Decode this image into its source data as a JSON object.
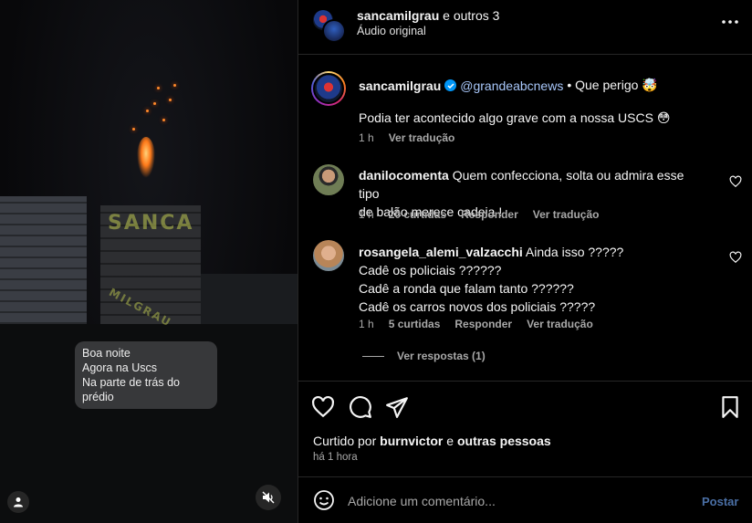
{
  "header": {
    "username": "sancamilgrau",
    "and_others": "e outros 3",
    "audio": "Áudio original",
    "more_icon": "more-horizontal-icon"
  },
  "video": {
    "watermark": "SANCA",
    "watermark2": "MILGRAU",
    "caption_lines": [
      "Boa noite",
      "Agora na Uscs",
      "Na parte de trás do prédio"
    ],
    "user_icon": "person-icon",
    "mute_icon": "speaker-muted-icon"
  },
  "post_caption": {
    "username": "sancamilgrau",
    "mention": "@grandeabcnews",
    "text1": "• Que perigo 🤯",
    "text2": "Podia ter acontecido algo grave com a nossa USCS 😳",
    "time": "1 h",
    "translate": "Ver tradução"
  },
  "comments": [
    {
      "username": "danilocomenta",
      "text_first": "Quem confecciona, solta ou admira esse tipo",
      "text_rest": [
        "de balão merece cadeia !"
      ],
      "time": "1 h",
      "likes": "20 curtidas",
      "reply": "Responder",
      "translate": "Ver tradução"
    },
    {
      "username": "rosangela_alemi_valzacchi",
      "text_first": "Ainda isso ?????",
      "text_rest": [
        "Cadê os policiais ??????",
        "Cadê a ronda que falam tanto ??????",
        "Cadê os carros novos dos policiais ?????"
      ],
      "time": "1 h",
      "likes": "5 curtidas",
      "reply": "Responder",
      "translate": "Ver tradução"
    }
  ],
  "view_replies": "Ver respostas (1)",
  "liked_by": {
    "prefix": "Curtido por",
    "user": "burnvictor",
    "mid": "e",
    "others": "outras pessoas"
  },
  "time_ago": "há 1 hora",
  "add_comment": {
    "placeholder": "Adicione um comentário...",
    "post_label": "Postar"
  },
  "colors": {
    "accent": "#0095f6",
    "post_disabled": "#4a6fa5",
    "muted": "#a8a8a8"
  }
}
